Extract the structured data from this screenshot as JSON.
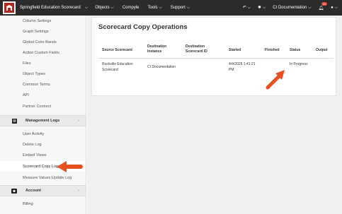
{
  "topbar": {
    "org": "Springfield Education Scorecard",
    "nav": [
      "Objects",
      "Compyle",
      "Tools",
      "Support"
    ],
    "workspace": "CI Documentation",
    "notification_count": "10"
  },
  "sidebar": {
    "items_top": [
      "Column Settings",
      "Graph Settings",
      "Global Color Bands",
      "Action Custom Fields",
      "Files",
      "Object Types",
      "Common Terms",
      "API",
      "Partner Connect"
    ],
    "sections": [
      {
        "label": "Management Logs",
        "items": [
          "User Activity",
          "Delete Log",
          "Embed Views",
          "Scorecard Copy Log",
          "Measure Values Update Log"
        ]
      },
      {
        "label": "Account",
        "items": [
          "Billing"
        ]
      }
    ],
    "active": "Scorecard Copy Log"
  },
  "main": {
    "title": "Scorecard Copy Operations",
    "columns": [
      "Source Scorecard",
      "Destination Instance",
      "Destination Scorecard ID",
      "Started",
      "Finished",
      "Status",
      "Output"
    ],
    "rows": [
      {
        "source": "Rockville Education Scorecard",
        "dest_instance": "CI Documentation",
        "dest_id": "",
        "started": "4/4/2025 1:41:21 PM",
        "finished": "",
        "status": "In Progress",
        "output": ""
      }
    ]
  },
  "colors": {
    "accent": "#e8501f",
    "topbar": "#2b2b2b"
  }
}
